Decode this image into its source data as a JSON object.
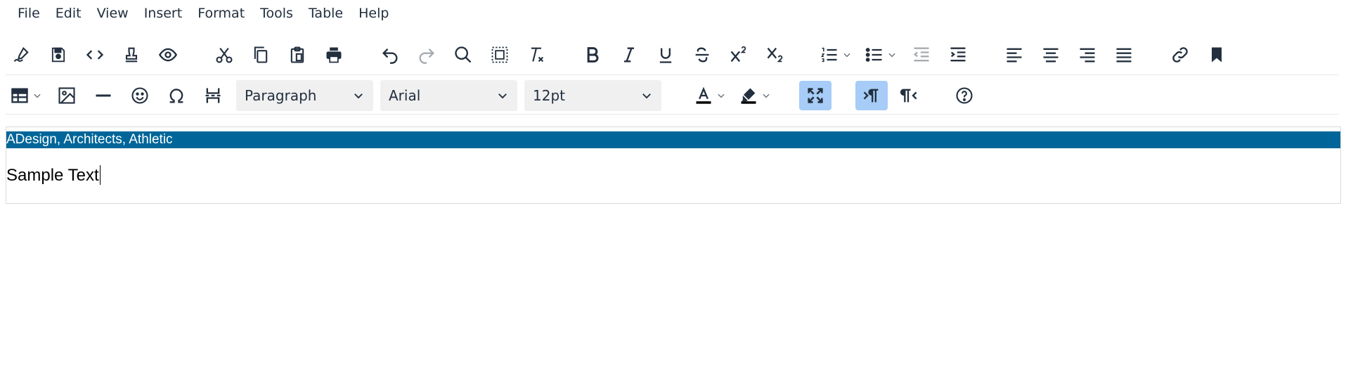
{
  "menubar": {
    "items": [
      "File",
      "Edit",
      "View",
      "Insert",
      "Format",
      "Tools",
      "Table",
      "Help"
    ]
  },
  "toolbar": {
    "block_format": "Paragraph",
    "font_family": "Arial",
    "font_size": "12pt"
  },
  "content": {
    "banner_text": "ADesign, Architects, Athletic",
    "paragraph_text": "Sample Text"
  },
  "colors": {
    "banner_bg": "#006699",
    "active_button": "#a6ccf7",
    "select_bg": "#f0f0f0",
    "icon": "#222f3e"
  }
}
